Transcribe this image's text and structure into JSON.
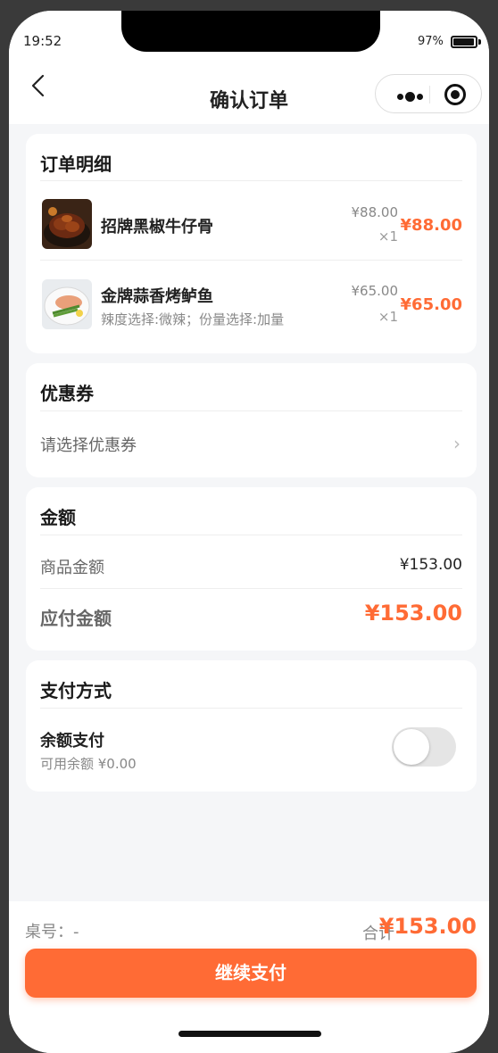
{
  "status_bar": {
    "time": "19:52",
    "battery_pct": "97%",
    "battery_level": 0.97
  },
  "nav": {
    "title": "确认订单"
  },
  "order": {
    "heading": "订单明细",
    "items": [
      {
        "name": "招牌黑椒牛仔骨",
        "spec": "",
        "unit_price": "¥88.00",
        "qty": "×1",
        "subtotal": "¥88.00",
        "icon": "beef-ribs-photo"
      },
      {
        "name": "金牌蒜香烤鲈鱼",
        "spec": "辣度选择:微辣；份量选择:加量",
        "unit_price": "¥65.00",
        "qty": "×1",
        "subtotal": "¥65.00",
        "icon": "grilled-fish-photo"
      }
    ]
  },
  "coupon": {
    "heading": "优惠券",
    "placeholder": "请选择优惠券",
    "chevron": "›"
  },
  "amount": {
    "heading": "金额",
    "goods_label": "商品金额",
    "goods_value": "¥153.00",
    "payable_label": "应付金额",
    "payable_value": "¥153.00"
  },
  "payment": {
    "heading": "支付方式",
    "balance_label": "余额支付",
    "balance_available": "可用余额 ¥0.00",
    "toggle_on": false
  },
  "footer": {
    "table_label": "桌号：-",
    "total_label": "合计",
    "total_value": "¥153.00",
    "pay_button": "继续支付"
  },
  "colors": {
    "accent": "#ff6b35",
    "background": "#f5f6f8"
  }
}
